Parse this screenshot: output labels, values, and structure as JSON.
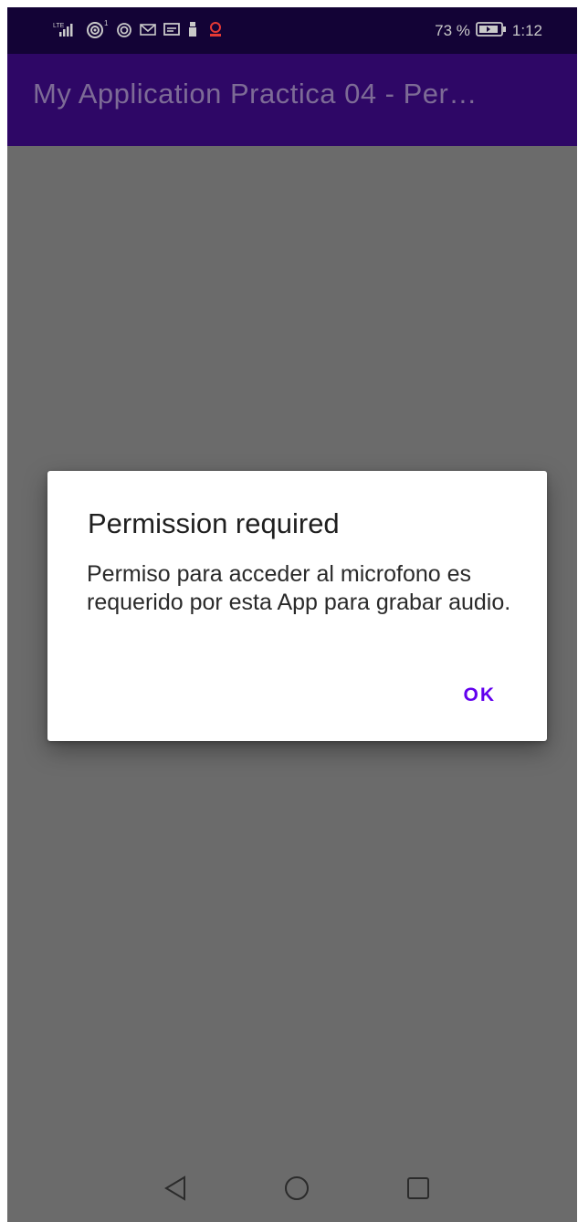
{
  "status_bar": {
    "battery_percent": "73 %",
    "time": "1:12",
    "network_label": "LTE",
    "icons": [
      "lte-signal-icon",
      "hotspot-icon",
      "wifi-icon",
      "gmail-icon",
      "message-icon",
      "usb-icon",
      "notification-icon",
      "battery-icon"
    ]
  },
  "app_bar": {
    "title": "My Application Practica 04 - Per…"
  },
  "dialog": {
    "title": "Permission required",
    "message": "Permiso para acceder al microfono es requerido por esta App para grabar audio.",
    "ok_label": "OK",
    "accent_color": "#6200ee"
  },
  "nav_bar": {
    "icons": [
      "back-icon",
      "home-icon",
      "recents-icon"
    ]
  },
  "colors": {
    "status_bar": "#130336",
    "app_bar": "#2e0766",
    "scrim_background": "#6b6b6b",
    "dialog_background": "#ffffff"
  }
}
